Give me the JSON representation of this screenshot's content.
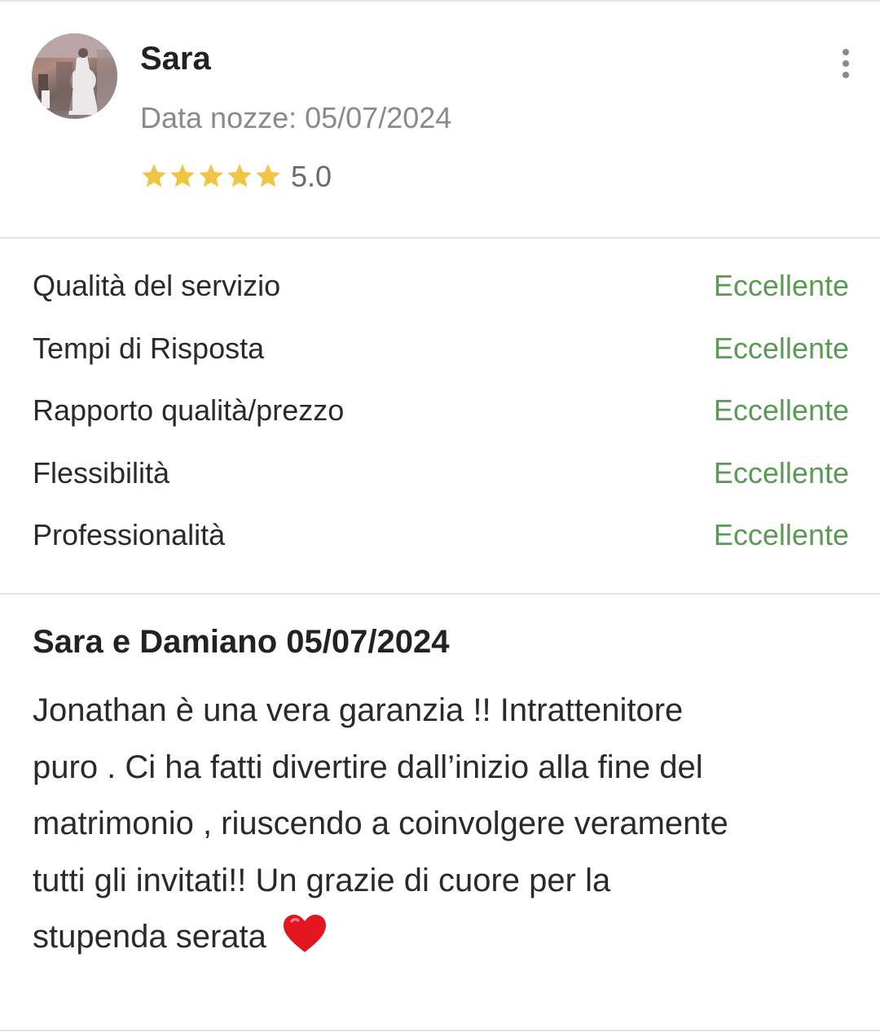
{
  "review": {
    "author_name": "Sara",
    "wedding_date_label": "Data nozze: 05/07/2024",
    "rating_value": 5.0,
    "rating_display": "5.0",
    "star_count": 5,
    "star_color": "#f2c443"
  },
  "ratings": [
    {
      "label": "Qualità del servizio",
      "value": "Eccellente"
    },
    {
      "label": "Tempi di Risposta",
      "value": "Eccellente"
    },
    {
      "label": "Rapporto qualità/prezzo",
      "value": "Eccellente"
    },
    {
      "label": "Flessibilità",
      "value": "Eccellente"
    },
    {
      "label": "Professionalità",
      "value": "Eccellente"
    }
  ],
  "review_text": {
    "title": "Sara e Damiano 05/07/2024",
    "lines": [
      "Jonathan è una vera garanzia !! Intrattenitore",
      "puro . Ci ha fatti divertire dall’inizio alla fine del",
      "matrimonio , riuscendo a coinvolgere veramente",
      "tutti gli invitati!! Un grazie di cuore per la",
      "stupenda serata"
    ],
    "trailing_emoji": "heart-emoji"
  },
  "icons": {
    "more_menu": "more-vertical-icon",
    "star": "star-icon"
  },
  "colors": {
    "accent_green": "#5a9a55",
    "muted_text": "#8a8a8a",
    "divider": "#e3e3e3"
  }
}
